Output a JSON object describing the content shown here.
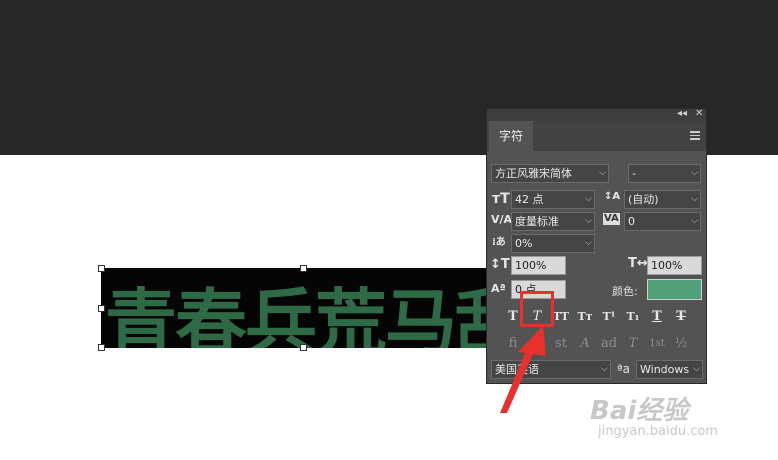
{
  "canvas": {
    "text_layer": {
      "text": "青春兵荒马乱",
      "color": "#2e6a45",
      "background": "#050505"
    }
  },
  "panel": {
    "collapse_icon": "◂◂",
    "close_icon": "✕",
    "tab_label": "字符",
    "font_family": "方正风雅宋简体",
    "font_style": "-",
    "font_size": "42 点",
    "leading": "(自动)",
    "kerning": "度量标准",
    "tracking": "0",
    "tsume": "0%",
    "vertical_scale": "100%",
    "horizontal_scale": "100%",
    "baseline_shift": "0 点",
    "color_label": "颜色:",
    "color_value": "#52a07a",
    "type_buttons": [
      "T",
      "T",
      "TT",
      "Tт",
      "T¹",
      "T₁",
      "T",
      "T"
    ],
    "opentype_buttons": [
      "fi",
      "ơ",
      "st",
      "A",
      "ad",
      "T",
      "1st",
      "½"
    ],
    "language": "美国英语",
    "aa_label": "a",
    "antialias": "Windows"
  },
  "watermark": {
    "brand": "Bai经验",
    "url": "jingyan.baidu.com"
  }
}
